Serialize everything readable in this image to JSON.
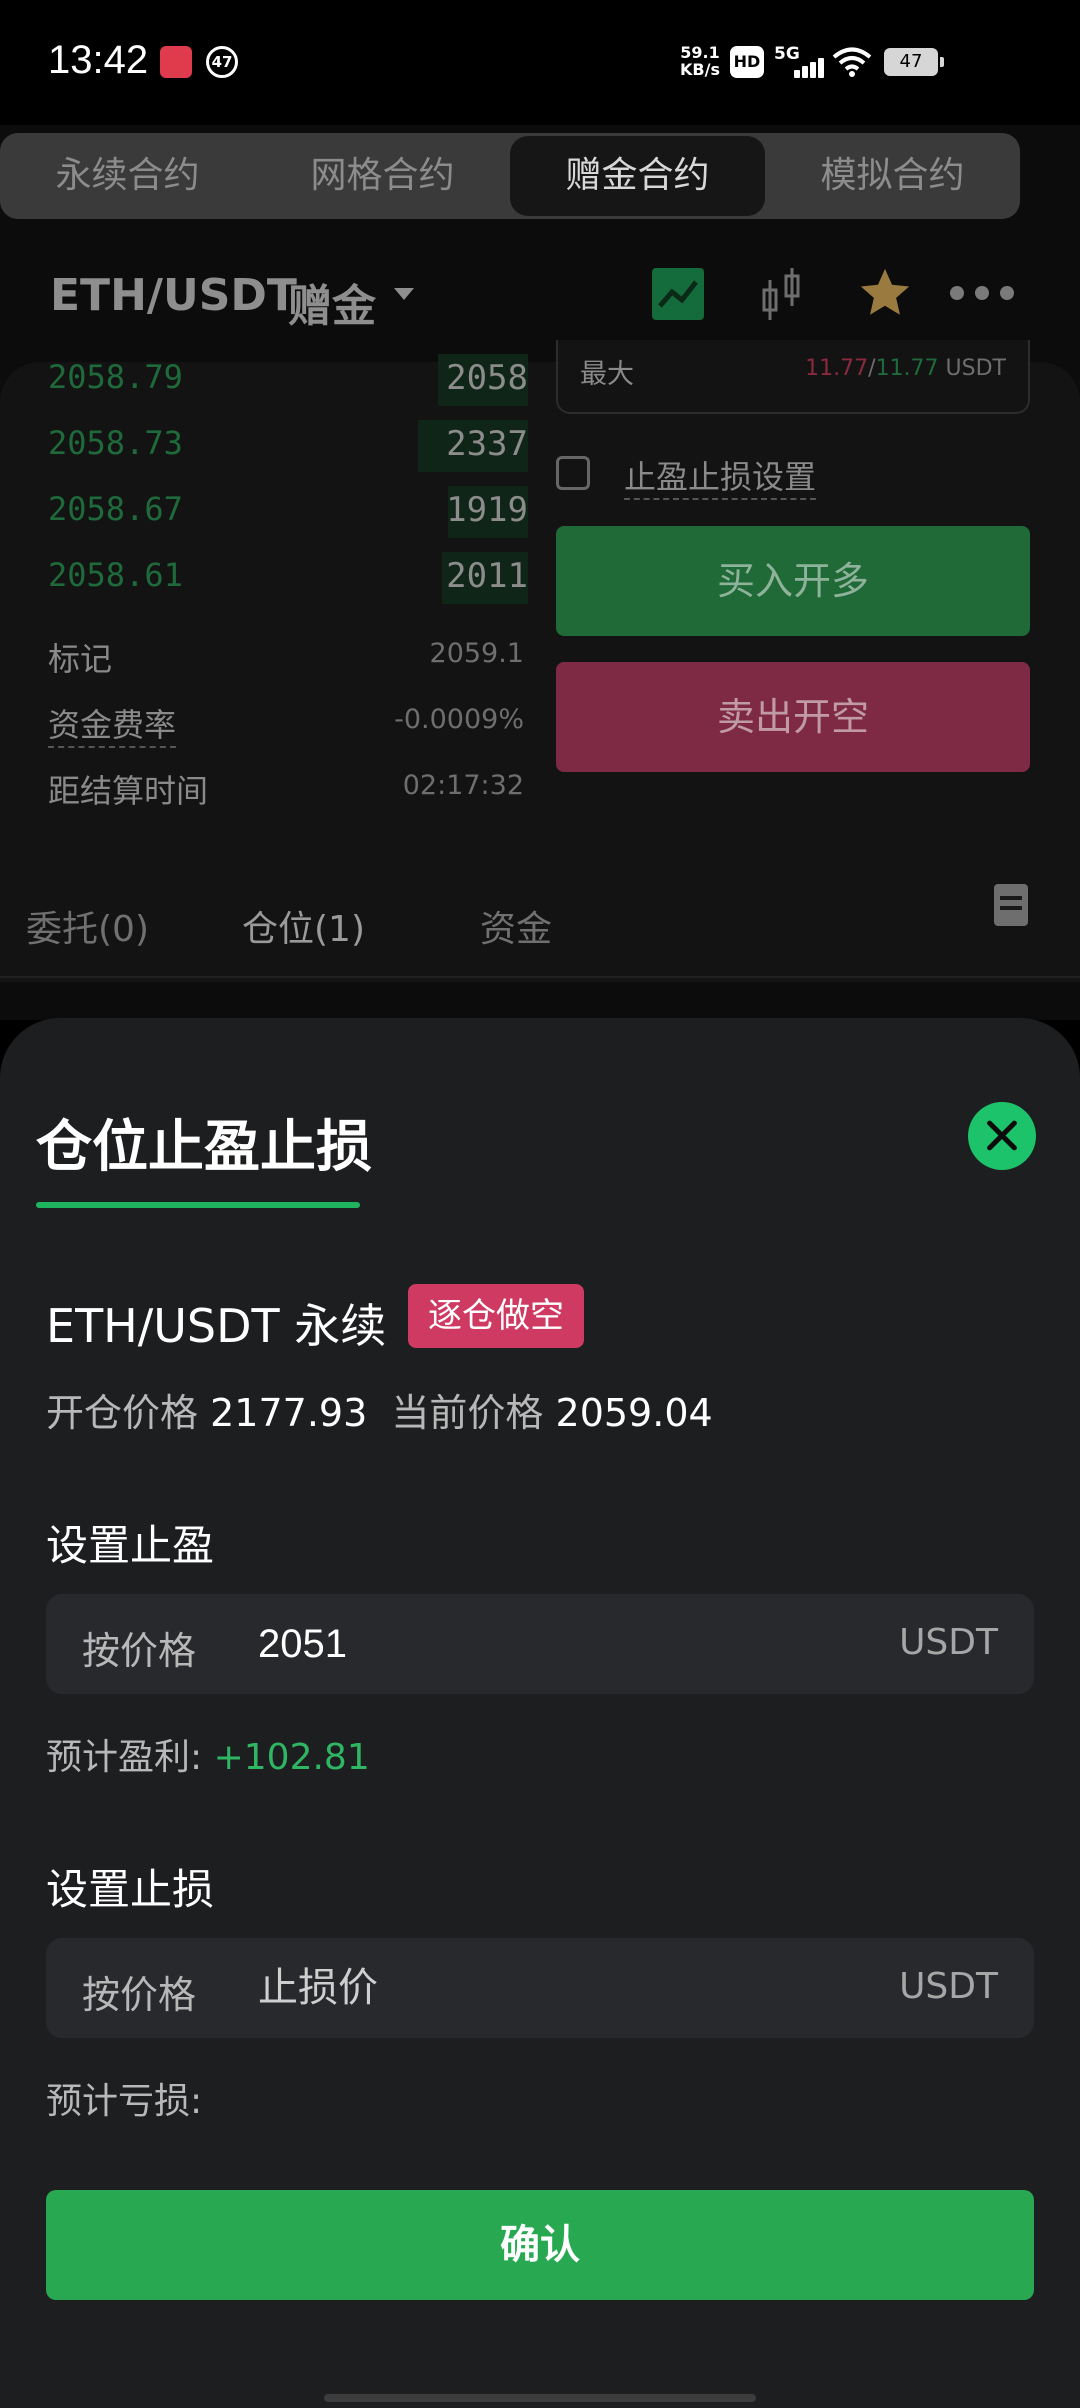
{
  "status_bar": {
    "time": "13:42",
    "notification_badge": "47",
    "net_speed": "59.1",
    "net_unit": "KB/s",
    "hd": "HD",
    "network": "5G",
    "battery": "47"
  },
  "contract_tabs": [
    {
      "label": "永续合约",
      "active": false
    },
    {
      "label": "网格合约",
      "active": false
    },
    {
      "label": "赠金合约",
      "active": true
    },
    {
      "label": "模拟合约",
      "active": false
    }
  ],
  "pair_bar": {
    "pair": "ETH/USDT",
    "tag": "赠金",
    "icons": [
      "chart-line-icon",
      "kline-icon",
      "star-icon",
      "more-icon"
    ]
  },
  "order_book": [
    {
      "price": "2058.79",
      "qty": "2058"
    },
    {
      "price": "2058.73",
      "qty": "2337"
    },
    {
      "price": "2058.67",
      "qty": "1919"
    },
    {
      "price": "2058.61",
      "qty": "2011"
    }
  ],
  "market_info": [
    {
      "label": "标记",
      "value": "2059.1"
    },
    {
      "label": "资金费率",
      "value": "-0.0009%"
    },
    {
      "label": "距结算时间",
      "value": "02:17:32"
    }
  ],
  "order_form": {
    "max_label": "最大",
    "max_sell": "11.77",
    "max_buy": "11.77",
    "max_unit": "USDT",
    "tpsl_label": "止盈止损设置",
    "buy_label": "买入开多",
    "sell_label": "卖出开空"
  },
  "bottom_tabs": [
    {
      "label": "委托(0)",
      "active": false
    },
    {
      "label": "仓位(1)",
      "active": true
    },
    {
      "label": "资金",
      "active": false
    }
  ],
  "sheet": {
    "title": "仓位止盈止损",
    "symbol": "ETH/USDT 永续",
    "side_badge": "逐仓做空",
    "entry_label": "开仓价格",
    "entry_price": "2177.93",
    "current_label": "当前价格",
    "current_price": "2059.04",
    "take_profit": {
      "title": "设置止盈",
      "prefix": "按价格",
      "value": "2051",
      "placeholder": "",
      "unit": "USDT",
      "estimate_label": "预计盈利:",
      "estimate_value": "+102.81"
    },
    "stop_loss": {
      "title": "设置止损",
      "prefix": "按价格",
      "value": "",
      "placeholder": "止损价",
      "unit": "USDT",
      "estimate_label": "预计亏损:",
      "estimate_value": ""
    },
    "confirm_label": "确认"
  },
  "colors": {
    "accent_green": "#27a851",
    "gain_green": "#2fb663",
    "short_badge": "#cf3a63",
    "sheet_bg": "#1d1e20"
  }
}
